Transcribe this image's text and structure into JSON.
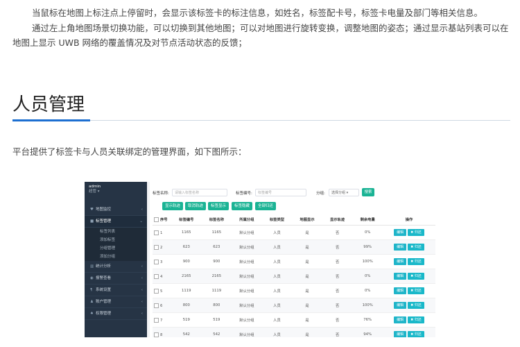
{
  "article": {
    "para1": "当鼠标在地图上标注点上停留时，会显示该标签卡的标注信息，如姓名，标签配卡号，标签卡电量及部门等相关信息。",
    "para2": "通过左上角地图场景切换功能，可以切换到其他地图；可以对地图进行旋转变换，调整地图的姿态；通过显示基站列表可以在地图上显示 UWB 网络的覆盖情况及对节点活动状态的反馈；",
    "heading": "人员管理",
    "para3": "平台提供了标签卡与人员关联绑定的管理界面，如下图所示："
  },
  "screenshot": {
    "sidebar": {
      "user_name": "admin",
      "user_role": "超管 ▾",
      "items": [
        {
          "icon": "location-icon",
          "glyph": "♥",
          "label": "地图监控",
          "chev": "‹"
        },
        {
          "icon": "tag-icon",
          "glyph": "■",
          "label": "标签管理",
          "chev": "⌄"
        }
      ],
      "sub_items": [
        "标签列表",
        "添加标签",
        "分组管理",
        "添加分组"
      ],
      "items2": [
        {
          "icon": "chart-icon",
          "glyph": "▥",
          "label": "统计分析",
          "chev": "‹"
        },
        {
          "icon": "alarm-icon",
          "glyph": "◉",
          "label": "报警查看",
          "chev": "‹"
        },
        {
          "icon": "settings-icon",
          "glyph": "¶",
          "label": "系统设置",
          "chev": "‹"
        },
        {
          "icon": "user-icon",
          "glyph": "♟",
          "label": "账户管理",
          "chev": "‹"
        },
        {
          "icon": "lock-icon",
          "glyph": "♠",
          "label": "权限管理",
          "chev": "‹"
        }
      ]
    },
    "filters": {
      "name_label": "标签名称:",
      "name_placeholder": "请输入标签名称",
      "code_label": "标签编号:",
      "code_placeholder": "标签编号",
      "group_label": "分组:",
      "group_value": "选择分组",
      "search_label": "搜索"
    },
    "actions": [
      "显示轨迹",
      "取消轨迹",
      "标签显示",
      "标签隐藏",
      "全部归还"
    ],
    "table": {
      "headers": [
        "序号",
        "标签编号",
        "标签名称",
        "所属分组",
        "标签类型",
        "地图显示",
        "显示轨迹",
        "剩余电量",
        "操作"
      ],
      "edit_label": "编辑",
      "return_label": "✖ 归还",
      "rows": [
        [
          "1",
          "1165",
          "1165",
          "默认分组",
          "人员",
          "是",
          "否",
          "0%"
        ],
        [
          "2",
          "623",
          "623",
          "默认分组",
          "人员",
          "是",
          "否",
          "99%"
        ],
        [
          "3",
          "900",
          "900",
          "默认分组",
          "人员",
          "是",
          "否",
          "100%"
        ],
        [
          "4",
          "2165",
          "2165",
          "默认分组",
          "人员",
          "是",
          "否",
          "0%"
        ],
        [
          "5",
          "1119",
          "1119",
          "默认分组",
          "人员",
          "是",
          "否",
          "0%"
        ],
        [
          "6",
          "800",
          "800",
          "默认分组",
          "人员",
          "是",
          "否",
          "100%"
        ],
        [
          "7",
          "519",
          "519",
          "默认分组",
          "人员",
          "是",
          "否",
          "76%"
        ],
        [
          "8",
          "542",
          "542",
          "默认分组",
          "人员",
          "是",
          "否",
          "94%"
        ]
      ]
    }
  }
}
